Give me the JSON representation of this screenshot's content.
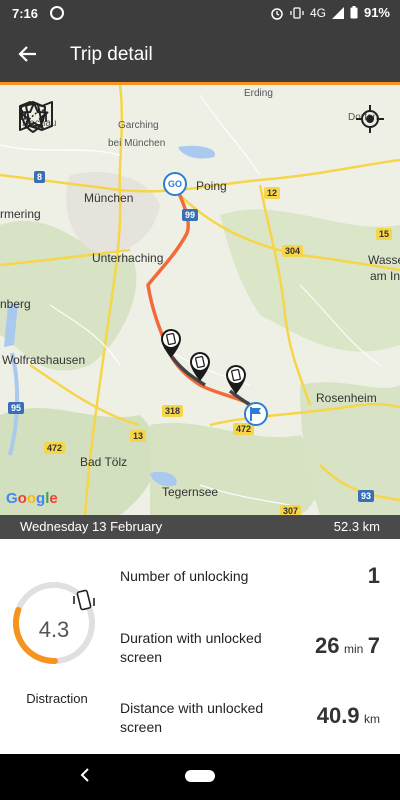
{
  "status_bar": {
    "time": "7:16",
    "network": "4G",
    "battery": "91%"
  },
  "app_bar": {
    "title": "Trip detail"
  },
  "map": {
    "labels": {
      "dachau": "Dachau",
      "erding": "Erding",
      "garching": "Garching",
      "bei_muenchen": "bei München",
      "poing": "Poing",
      "muenchen": "München",
      "ermering": "rmering",
      "unterhaching": "Unterhaching",
      "wasser": "Wasse",
      "am_in": "am In",
      "nberg": "nberg",
      "wolfratshausen": "Wolfratshausen",
      "rosenheim": "Rosenheim",
      "bad_toelz": "Bad Tölz",
      "tegernsee": "Tegernsee",
      "dorfen": "Dorfen"
    },
    "road_badges": {
      "r8": "8",
      "r99": "99",
      "r12": "12",
      "r304": "304",
      "r15": "15",
      "r95": "95",
      "r318": "318",
      "r13": "13",
      "r472": "472",
      "r307": "307",
      "r93": "93"
    },
    "go_marker": "GO",
    "google": [
      "G",
      "o",
      "o",
      "g",
      "l",
      "e"
    ],
    "icons": {
      "tool_1": "shield-icon",
      "tool_2": "star-icon",
      "tool_3": "phone-shake-icon",
      "tool_4": "map-route-icon",
      "locate": "crosshair-icon"
    },
    "route_color": "#f26a3a"
  },
  "trip": {
    "date": "Wednesday 13 February",
    "distance": "52.3 km"
  },
  "stats": {
    "distraction_score": "4.3",
    "distraction_level": 0.43,
    "distraction_label": "Distraction",
    "unlocking_label": "Number of unlocking",
    "unlocking_value": "1",
    "duration_label": "Duration with unlocked screen",
    "duration_minutes": "26",
    "duration_min_unit": "min",
    "duration_seconds": "7",
    "distance_label": "Distance with unlocked screen",
    "distance_value": "40.9",
    "distance_unit": "km"
  },
  "colors": {
    "accent": "#f7941d",
    "bar": "#3d3d3d"
  }
}
